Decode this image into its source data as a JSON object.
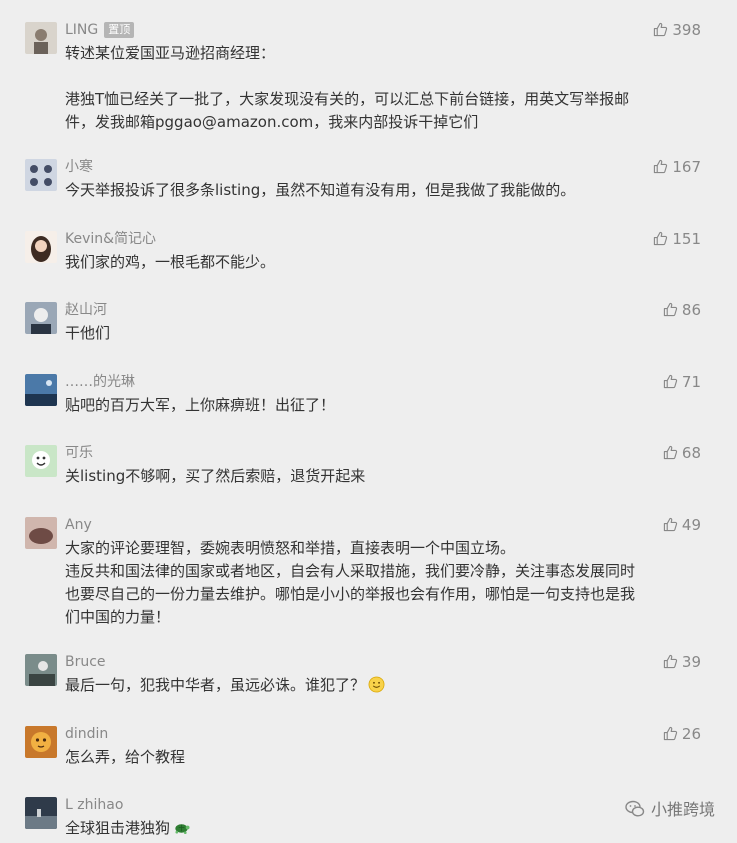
{
  "comments": [
    {
      "nickname": "LING",
      "badge": "置顶",
      "likes": "398",
      "lines": [
        "转述某位爱国亚马逊招商经理：",
        "",
        "港独T恤已经关了一批了，大家发现没有关的，可以汇总下前台链接，用英文写举报邮",
        "件，发我邮箱pggao@amazon.com，我来内部投诉干掉它们"
      ]
    },
    {
      "nickname": "小寒",
      "likes": "167",
      "lines": [
        "今天举报投诉了很多条listing，虽然不知道有没有用，但是我做了我能做的。"
      ]
    },
    {
      "nickname": "Kevin&简记心",
      "likes": "151",
      "lines": [
        "我们家的鸡，一根毛都不能少。"
      ]
    },
    {
      "nickname": "赵山河",
      "likes": "86",
      "lines": [
        "干他们"
      ]
    },
    {
      "nickname": "……的光琳",
      "likes": "71",
      "lines": [
        "贴吧的百万大军，上你麻痹班！出征了！"
      ]
    },
    {
      "nickname": "可乐",
      "likes": "68",
      "lines": [
        "关listing不够啊，买了然后索赔，退货开起来"
      ]
    },
    {
      "nickname": "Any",
      "likes": "49",
      "lines": [
        "大家的评论要理智，委婉表明愤怒和举措，直接表明一个中国立场。",
        "违反共和国法律的国家或者地区，自会有人采取措施，我们要冷静，关注事态发展同时",
        "也要尽自己的一份力量去维护。哪怕是小小的举报也会有作用，哪怕是一句支持也是我",
        "们中国的力量！"
      ]
    },
    {
      "nickname": "Bruce",
      "likes": "39",
      "lines": [
        "最后一句，犯我中华者，虽远必诛。谁犯了？"
      ],
      "emoji": "smile-emoji"
    },
    {
      "nickname": "dindin",
      "likes": "26",
      "lines": [
        "怎么弄，给个教程"
      ]
    },
    {
      "nickname": "L zhihao",
      "likes": "",
      "lines": [
        "全球狙击港独狗"
      ],
      "emoji": "turtle-emoji"
    }
  ],
  "watermark": "小推跨境",
  "icons": {
    "like": "thumbs-up-icon",
    "watermark": "wechat-icon"
  },
  "colors": {
    "background": "#eeeeee",
    "text": "#333333",
    "meta": "#888888"
  }
}
